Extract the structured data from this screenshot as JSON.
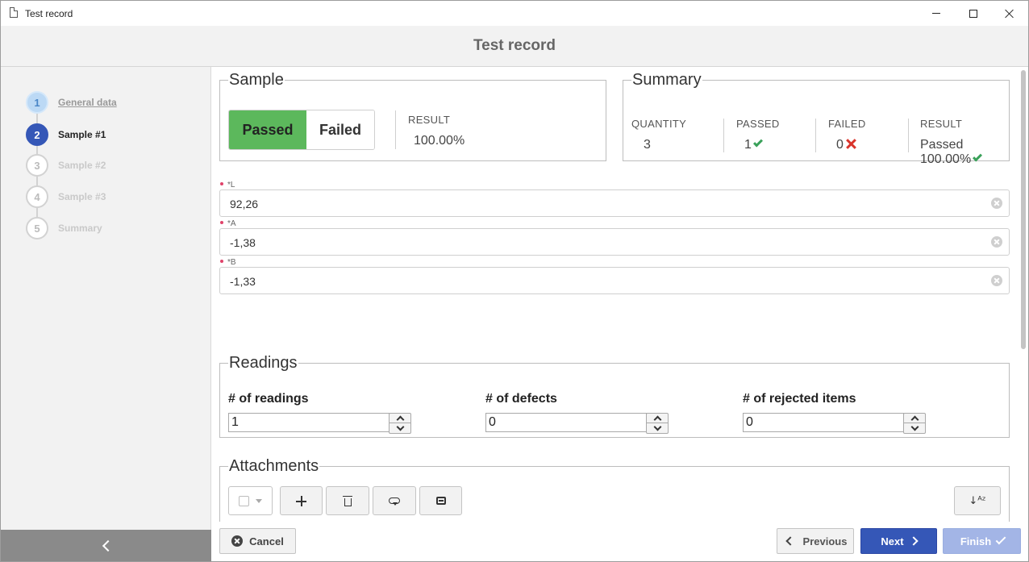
{
  "window": {
    "title": "Test record"
  },
  "header": {
    "title": "Test record"
  },
  "sidebar": {
    "steps": [
      {
        "number": "1",
        "label": "General data",
        "state": "done"
      },
      {
        "number": "2",
        "label": "Sample #1",
        "state": "active"
      },
      {
        "number": "3",
        "label": "Sample #2",
        "state": "pending"
      },
      {
        "number": "4",
        "label": "Sample #3",
        "state": "pending"
      },
      {
        "number": "5",
        "label": "Summary",
        "state": "pending"
      }
    ]
  },
  "sample": {
    "legend": "Sample",
    "passed_label": "Passed",
    "failed_label": "Failed",
    "selected": "Passed",
    "result_caption": "RESULT",
    "result_value": "100.00%"
  },
  "summary": {
    "legend": "Summary",
    "quantity_caption": "QUANTITY",
    "quantity_value": "3",
    "passed_caption": "PASSED",
    "passed_value": "1",
    "failed_caption": "FAILED",
    "failed_value": "0",
    "result_caption": "RESULT",
    "result_status": "Passed",
    "result_percent": "100.00%"
  },
  "fields": [
    {
      "label": "*L",
      "value": "92,26"
    },
    {
      "label": "*A",
      "value": "-1,38"
    },
    {
      "label": "*B",
      "value": "-1,33"
    }
  ],
  "readings": {
    "legend": "Readings",
    "num_readings_label": "# of readings",
    "num_readings_value": "1",
    "num_defects_label": "# of defects",
    "num_defects_value": "0",
    "num_rejected_label": "# of rejected items",
    "num_rejected_value": "0"
  },
  "attachments": {
    "legend": "Attachments",
    "icons": [
      "select-all-checkbox",
      "add-icon",
      "trash-icon",
      "download-cloud-icon",
      "scanner-icon",
      "sort-az-icon"
    ]
  },
  "footer": {
    "cancel_label": "Cancel",
    "previous_label": "Previous",
    "next_label": "Next",
    "finish_label": "Finish"
  },
  "colors": {
    "accent": "#3557b7",
    "passed": "#5cb85c",
    "check": "#3aa15a",
    "cross": "#d9342b",
    "required": "#e0436a"
  }
}
